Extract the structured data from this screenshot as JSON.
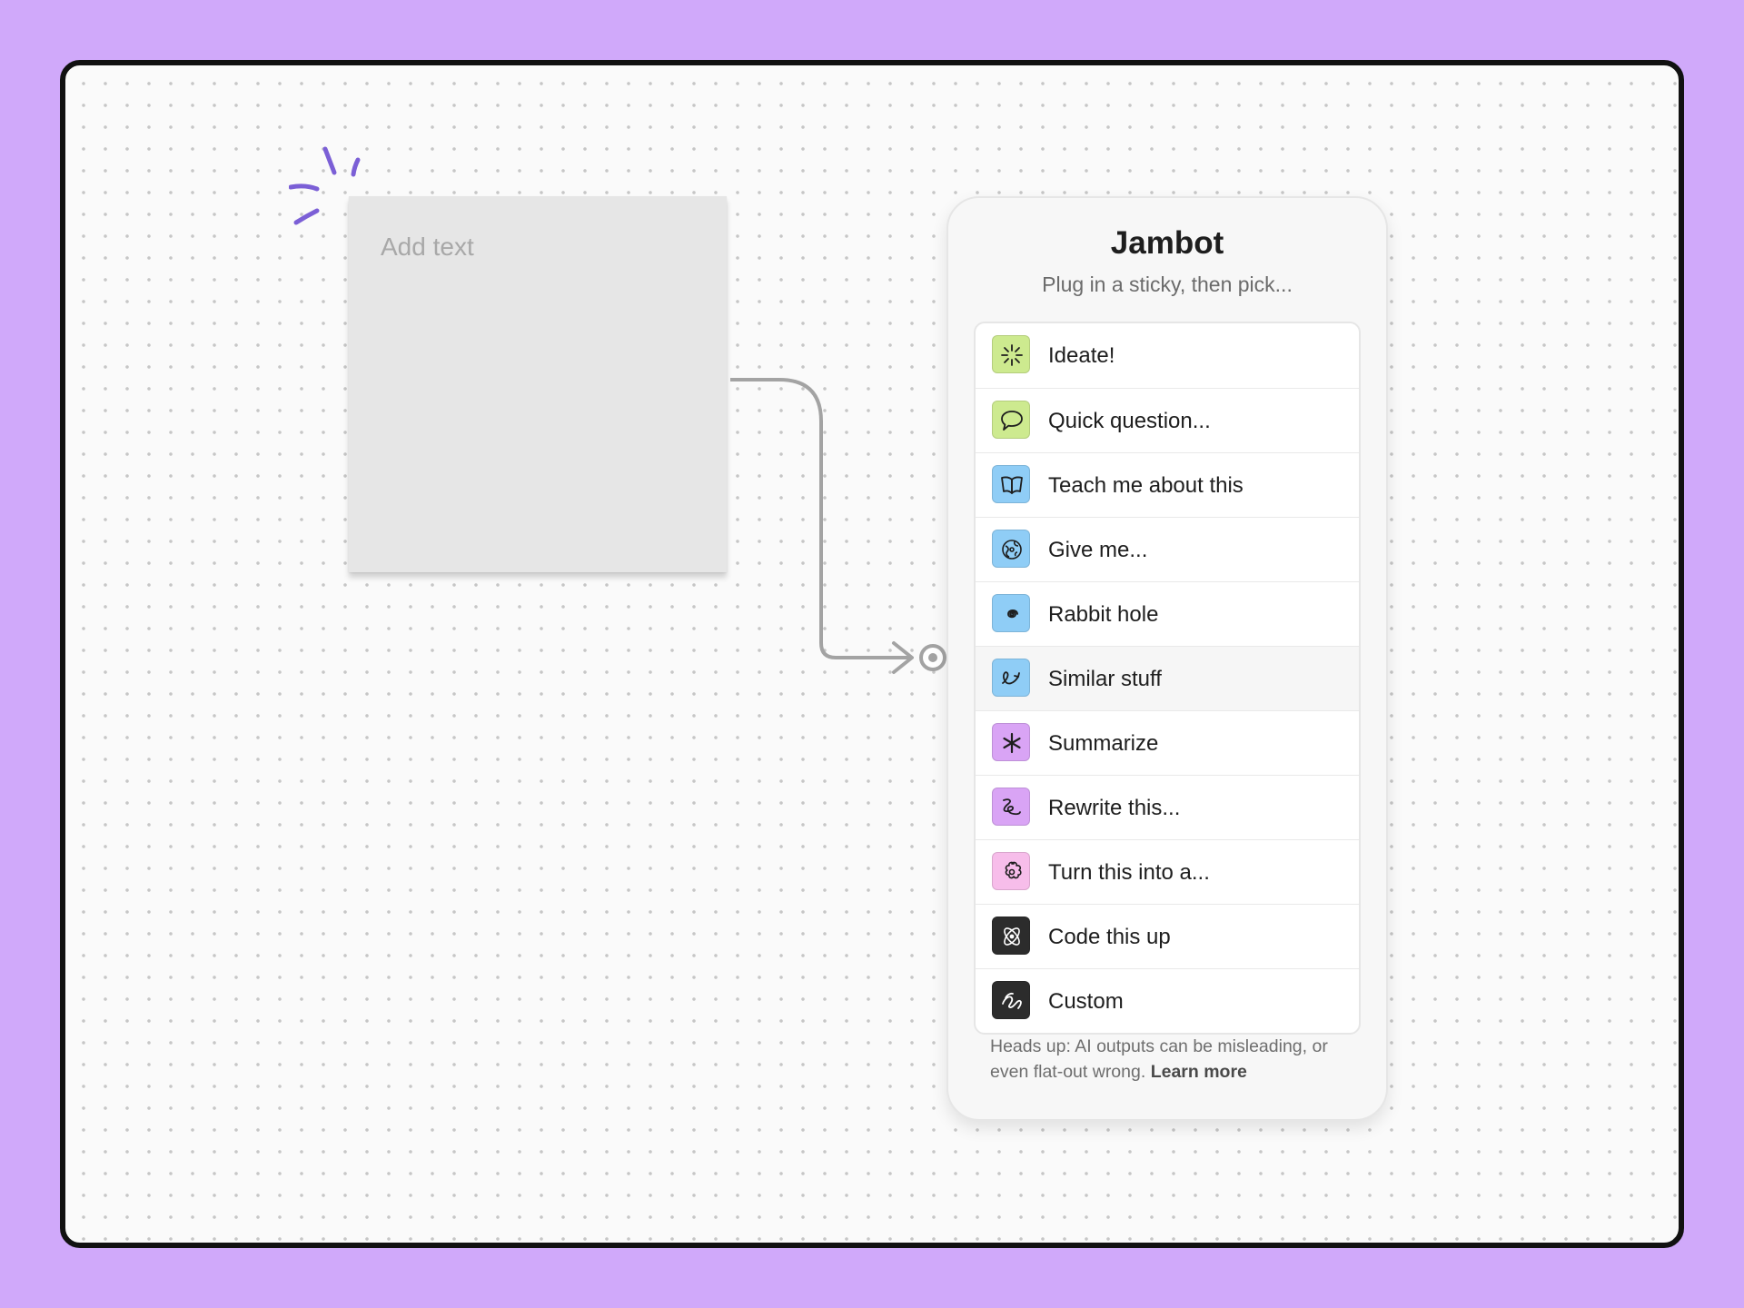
{
  "sticky": {
    "placeholder": "Add text"
  },
  "jambot": {
    "title": "Jambot",
    "subtitle": "Plug in a sticky, then pick...",
    "items": [
      {
        "name": "ideate",
        "label": "Ideate!",
        "icon": "sparkle-icon",
        "color": "#cdea8f"
      },
      {
        "name": "quick-question",
        "label": "Quick question...",
        "icon": "speech-bubble-icon",
        "color": "#cdea8f"
      },
      {
        "name": "teach-me",
        "label": "Teach me about this",
        "icon": "open-book-icon",
        "color": "#8fcdf6"
      },
      {
        "name": "give-me",
        "label": "Give me...",
        "icon": "globe-icon",
        "color": "#8fcdf6"
      },
      {
        "name": "rabbit-hole",
        "label": "Rabbit hole",
        "icon": "spiral-icon",
        "color": "#8fcdf6"
      },
      {
        "name": "similar-stuff",
        "label": "Similar stuff",
        "icon": "loop-arrow-icon",
        "color": "#8fcdf6"
      },
      {
        "name": "summarize",
        "label": "Summarize",
        "icon": "asterisk-icon",
        "color": "#d9a4f5"
      },
      {
        "name": "rewrite",
        "label": "Rewrite this...",
        "icon": "scribble-icon",
        "color": "#d9a4f5"
      },
      {
        "name": "turn-into",
        "label": "Turn this into a...",
        "icon": "flower-icon",
        "color": "#f7bdea"
      },
      {
        "name": "code-this-up",
        "label": "Code this up",
        "icon": "atom-icon",
        "color": "#2c2c2c"
      },
      {
        "name": "custom",
        "label": "Custom",
        "icon": "squiggle-icon",
        "color": "#2c2c2c"
      }
    ],
    "disclaimer_text": "Heads up: AI outputs can be misleading, or even flat-out wrong.",
    "learn_more": "Learn more"
  },
  "colors": {
    "background": "#d0a9fa",
    "sparkle_accent": "#7b5fd6",
    "connector": "#a3a3a3"
  }
}
